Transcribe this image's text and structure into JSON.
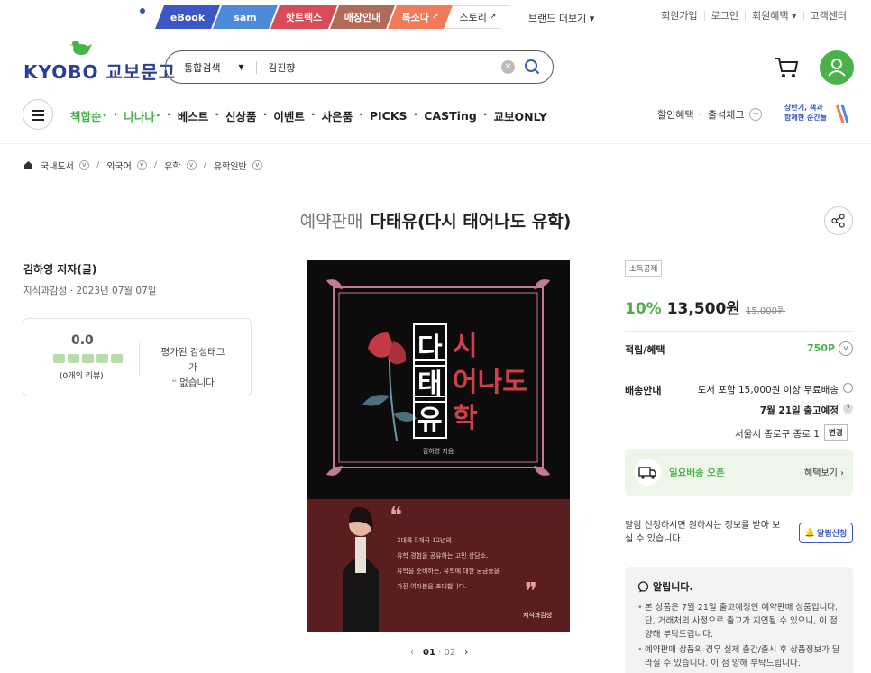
{
  "topbar": {
    "tabs": [
      "eBook",
      "sam",
      "핫트랙스",
      "매장안내",
      "톡소다",
      "스토리"
    ],
    "brand_more": "브랜드 더보기 ▾",
    "util": [
      "회원가입",
      "로그인",
      "회원혜택 ▾",
      "고객센터"
    ]
  },
  "header": {
    "logo_text": "KYOBO 교보문고",
    "search_category": "통합검색",
    "search_value": "김진향"
  },
  "nav": {
    "items": [
      "책합순",
      "나나나",
      "베스트",
      "신상품",
      "이벤트",
      "사은품",
      "PICKS",
      "CASTing",
      "교보ONLY"
    ],
    "right": [
      "할인혜택",
      "출석체크"
    ],
    "promo_line1": "상반기, 책과",
    "promo_line2": "함께한 순간들"
  },
  "breadcrumb": [
    "국내도서",
    "외국어",
    "유학",
    "유학일반"
  ],
  "product": {
    "pre_label": "예약판매",
    "title": "다태유(다시 태어나도 유학)",
    "author": "김하영 저자(글)",
    "pub": "지식과감성 · 2023년 07월 07일",
    "rating": "0.0",
    "reviews": "(0개의 리뷰)",
    "tag_line1": "평가된 감성태그가",
    "tag_line2": "없습니다",
    "pager_current": "01",
    "pager_total": "· 02"
  },
  "cover": {
    "title_chars": [
      "다",
      "시",
      "태",
      "어나도",
      "유",
      "학"
    ],
    "author": "김하영 지음",
    "quote_lines": [
      "3대륙 5개국 12년의",
      "유학 경험을 공유하는 고민 상담소.",
      "유학을 준비하는, 유학에 대한 궁금증을",
      "가진 여러분을 초대합니다."
    ],
    "publisher": "지식과감성"
  },
  "pricing": {
    "badge": "소득공제",
    "discount": "10%",
    "price": "13,500원",
    "original": "15,000원",
    "points_label": "적립/혜택",
    "points": "750P",
    "shipping_label": "배송안내",
    "shipping_free": "도서 포함 15,000원 이상 무료배송",
    "shipping_date": "7월 21일 출고예정",
    "address": "서울시 종로구 종로 1",
    "change_btn": "변경",
    "sunday": "일요배송 오픈",
    "benefit_link": "혜택보기 ›",
    "notify_text": "알림 신청하시면 원하시는 정보를 받아 보실 수 있습니다.",
    "notify_btn": "알림신청",
    "notice_title": "알립니다.",
    "notice_p1": "본 상품은 7월 21일 출고예정인 예약판매 상품입니다. 단, 거래처의 사정으로 출고가 지연될 수 있으니, 이 점 양해 부탁드립니다.",
    "notice_p2": "예약판매 상품의 경우 실제 출간/출시 후 상품정보가 달라질 수 있습니다. 이 점 양해 부탁드립니다."
  },
  "colors": {
    "brand_green": "#4bb24a",
    "brand_navy": "#2a3f8f",
    "accent_blue": "#3a57c5"
  }
}
